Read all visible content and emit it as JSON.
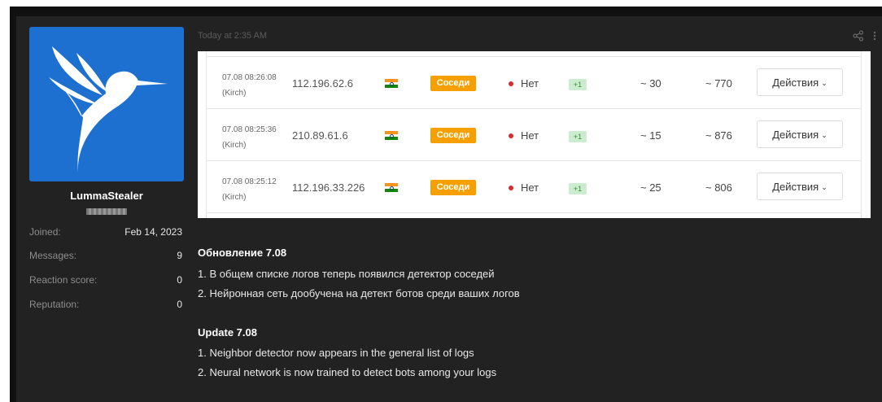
{
  "post": {
    "timestamp": "Today at 2:35 AM",
    "share_icon": "share-icon",
    "more_icon": "more-icon"
  },
  "user": {
    "name": "LummaStealer",
    "avatar_icon": "hummingbird-logo",
    "avatar_color": "#1d6fd0",
    "stats": [
      {
        "label": "Joined:",
        "value": "Feb 14, 2023"
      },
      {
        "label": "Messages:",
        "value": "9"
      },
      {
        "label": "Reaction score:",
        "value": "0"
      },
      {
        "label": "Reputation:",
        "value": "0"
      }
    ]
  },
  "embedded_table": {
    "rows": [
      {
        "date": "07.08 08:26:08",
        "source": "(Kirch)",
        "ip": "112.196.62.6",
        "flag": "india-flag",
        "badge": "Соседи",
        "status": "Нет",
        "plus": "+1",
        "v1": "~ 30",
        "v2": "~ 770",
        "action": "Действия"
      },
      {
        "date": "07.08 08:25:36",
        "source": "(Kirch)",
        "ip": "210.89.61.6",
        "flag": "india-flag",
        "badge": "Соседи",
        "status": "Нет",
        "plus": "+1",
        "v1": "~ 15",
        "v2": "~ 876",
        "action": "Действия"
      },
      {
        "date": "07.08 08:25:12",
        "source": "(Kirch)",
        "ip": "112.196.33.226",
        "flag": "india-flag",
        "badge": "Соседи",
        "status": "Нет",
        "plus": "+1",
        "v1": "~ 25",
        "v2": "~ 806",
        "action": "Действия"
      }
    ],
    "badge_color": "#f5a000",
    "status_dot_color": "#d92b2b"
  },
  "content": {
    "ru_title": "Обновление 7.08",
    "ru_line1": "1. В общем списке логов теперь появился детектор соседей",
    "ru_line2": "2. Нейронная сеть дообучена на детект ботов среди ваших логов",
    "en_title": "Update 7.08",
    "en_line1": "1. Neighbor detector now appears in the general list of logs",
    "en_line2": "2. Neural network is now trained to detect bots among your logs"
  }
}
